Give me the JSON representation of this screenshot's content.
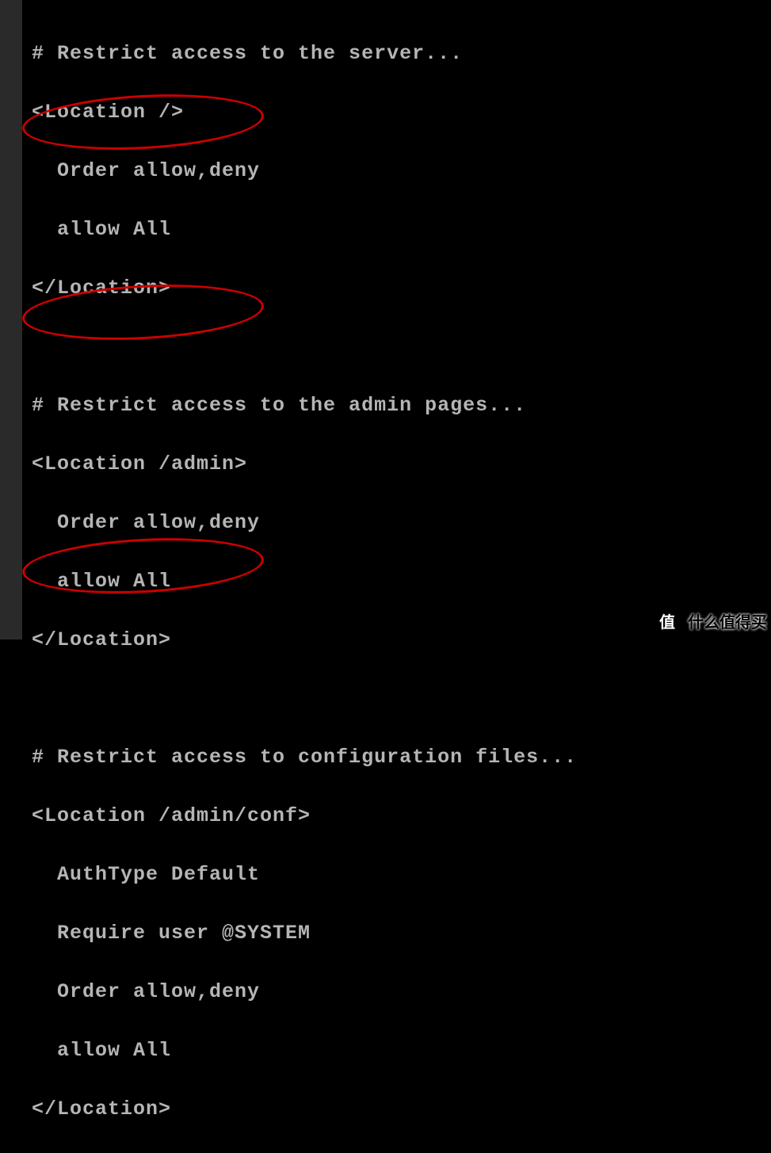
{
  "config": {
    "block1": {
      "comment": "# Restrict access to the server...",
      "open": "<Location />",
      "order": "  Order allow,deny",
      "allow": "  allow All",
      "close": "</Location>"
    },
    "block2": {
      "comment": "# Restrict access to the admin pages...",
      "open": "<Location /admin>",
      "order": "  Order allow,deny",
      "allow": "  allow All",
      "close": "</Location>"
    },
    "block3": {
      "comment": "# Restrict access to configuration files...",
      "open": "<Location /admin/conf>",
      "authtype": "  AuthType Default",
      "require": "  Require user @SYSTEM",
      "order": "  Order allow,deny",
      "allow": "  allow All",
      "close": "</Location>"
    }
  },
  "watermark": {
    "badge": "值",
    "text": "什么值得买"
  }
}
